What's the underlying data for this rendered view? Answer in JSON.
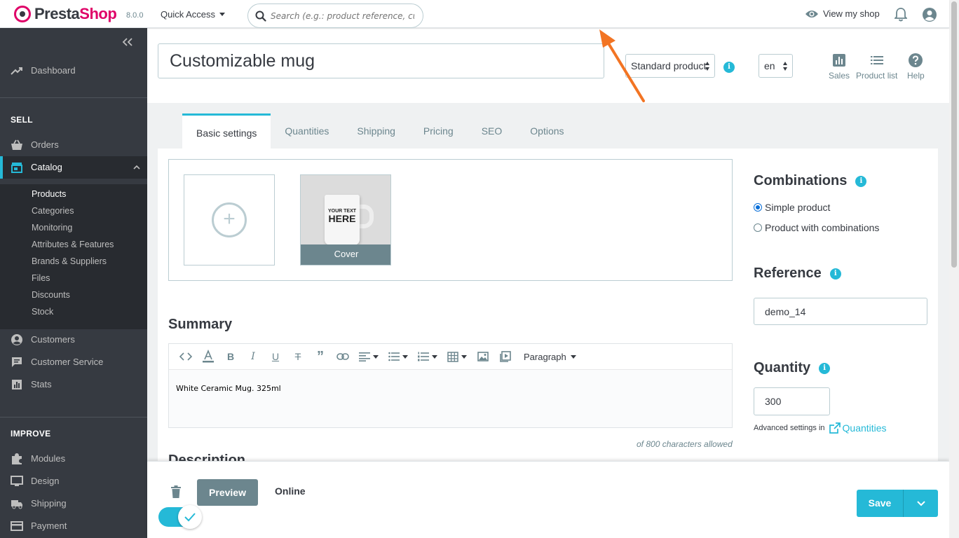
{
  "header": {
    "logo_part1": "Presta",
    "logo_part2": "Shop",
    "version": "8.0.0",
    "quick_access": "Quick Access",
    "search_placeholder": "Search (e.g.: product reference, custon",
    "view_shop": "View my shop"
  },
  "sidebar": {
    "dashboard": "Dashboard",
    "sell_heading": "SELL",
    "orders": "Orders",
    "catalog": "Catalog",
    "catalog_sub": [
      "Products",
      "Categories",
      "Monitoring",
      "Attributes & Features",
      "Brands & Suppliers",
      "Files",
      "Discounts",
      "Stock"
    ],
    "customers": "Customers",
    "customer_service": "Customer Service",
    "stats": "Stats",
    "improve_heading": "IMPROVE",
    "modules": "Modules",
    "design": "Design",
    "shipping": "Shipping",
    "payment": "Payment"
  },
  "product": {
    "name": "Customizable mug",
    "type_selected": "Standard product",
    "lang": "en",
    "tools": {
      "sales": "Sales",
      "product_list": "Product list",
      "help": "Help"
    }
  },
  "tabs": [
    "Basic settings",
    "Quantities",
    "Shipping",
    "Pricing",
    "SEO",
    "Options"
  ],
  "images": {
    "add_glyph": "+",
    "mug_text_line1": "YOUR TEXT",
    "mug_text_line2": "HERE",
    "cover_label": "Cover"
  },
  "summary": {
    "title": "Summary",
    "paragraph_label": "Paragraph",
    "text": "White Ceramic Mug. 325ml",
    "char_limit": "of 800 characters allowed"
  },
  "description_title": "Description",
  "right_panel": {
    "combinations_title": "Combinations",
    "simple_product": "Simple product",
    "with_combinations": "Product with combinations",
    "reference_title": "Reference",
    "reference_value": "demo_14",
    "quantity_title": "Quantity",
    "quantity_value": "300",
    "advanced_settings": "Advanced settings in",
    "quantities_link": "Quantities"
  },
  "footer": {
    "preview": "Preview",
    "online": "Online",
    "save": "Save"
  },
  "colors": {
    "accent": "#25b9d7",
    "sidebar_bg": "#363a41",
    "brand_pink": "#df0067",
    "annotation_arrow": "#f27423"
  }
}
